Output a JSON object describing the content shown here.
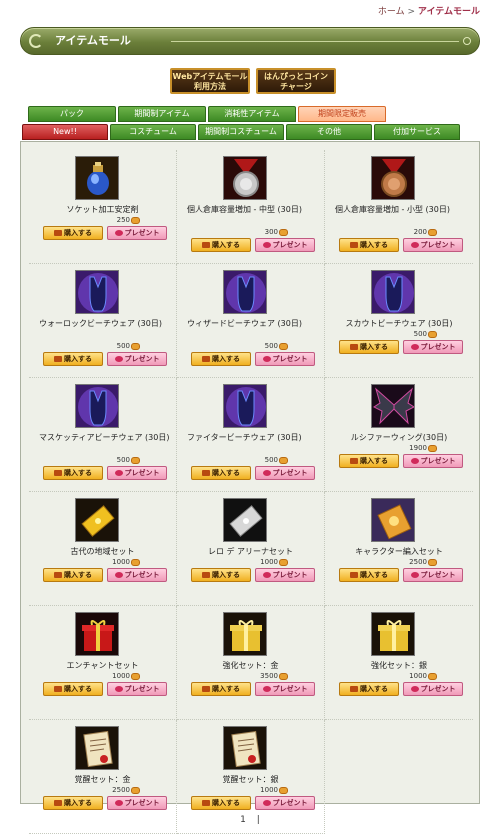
{
  "breadcrumb": {
    "home": "ホーム",
    "sep": ">",
    "current": "アイテムモール"
  },
  "page_title": "アイテムモール",
  "top_buttons": [
    {
      "label": "Webアイテムモール\n利用方法"
    },
    {
      "label": "はんぴっとコイン\nチャージ"
    }
  ],
  "tabs_row1": [
    {
      "label": "パック"
    },
    {
      "label": "期間制アイテム"
    },
    {
      "label": "消耗性アイテム"
    },
    {
      "label": "期間限定販売"
    }
  ],
  "tabs_row2": [
    {
      "label": "New!!"
    },
    {
      "label": "コスチューム"
    },
    {
      "label": "期間制コスチューム"
    },
    {
      "label": "その他"
    },
    {
      "label": "付加サービス"
    }
  ],
  "buy_label": "購入する",
  "gift_label": "プレゼント",
  "coin_icon": "coin-icon",
  "items": [
    {
      "name": "ソケット加工安定剤",
      "price": "250",
      "icon": "potion-icon"
    },
    {
      "name": "個人倉庫容量増加 - 中型 (30日)",
      "price": "300",
      "icon": "silver-medal-icon"
    },
    {
      "name": "個人倉庫容量増加 - 小型 (30日)",
      "price": "200",
      "icon": "bronze-medal-icon"
    },
    {
      "name": "ウォーロックビーチウェア (30日)",
      "price": "500",
      "icon": "swimsuit-icon"
    },
    {
      "name": "ウィザードビーチウェア (30日)",
      "price": "500",
      "icon": "swimsuit-icon"
    },
    {
      "name": "スカウトビーチウェア (30日)",
      "price": "500",
      "icon": "swimsuit-icon"
    },
    {
      "name": "マスケッティアビーチウェア (30日)",
      "price": "500",
      "icon": "swimsuit-icon"
    },
    {
      "name": "ファイタービーチウェア (30日)",
      "price": "500",
      "icon": "swimsuit-icon"
    },
    {
      "name": "ルシファーウィング(30日)",
      "price": "1900",
      "icon": "wings-icon"
    },
    {
      "name": "古代の地域セット",
      "price": "1000",
      "icon": "gold-ticket-icon"
    },
    {
      "name": "レロ デ アリーナセット",
      "price": "1000",
      "icon": "silver-ticket-icon"
    },
    {
      "name": "キャラクター編入セット",
      "price": "2500",
      "icon": "card-icon"
    },
    {
      "name": "エンチャントセット",
      "price": "1000",
      "icon": "red-gift-icon"
    },
    {
      "name": "強化セット：金",
      "price": "3500",
      "icon": "gold-gift-icon"
    },
    {
      "name": "強化セット：銀",
      "price": "1000",
      "icon": "gold-gift-icon"
    },
    {
      "name": "覚醒セット：金",
      "price": "2500",
      "icon": "scroll-icon"
    },
    {
      "name": "覚醒セット：銀",
      "price": "1000",
      "icon": "scroll-icon"
    }
  ],
  "pagination": {
    "current": "1",
    "sep": "|"
  }
}
